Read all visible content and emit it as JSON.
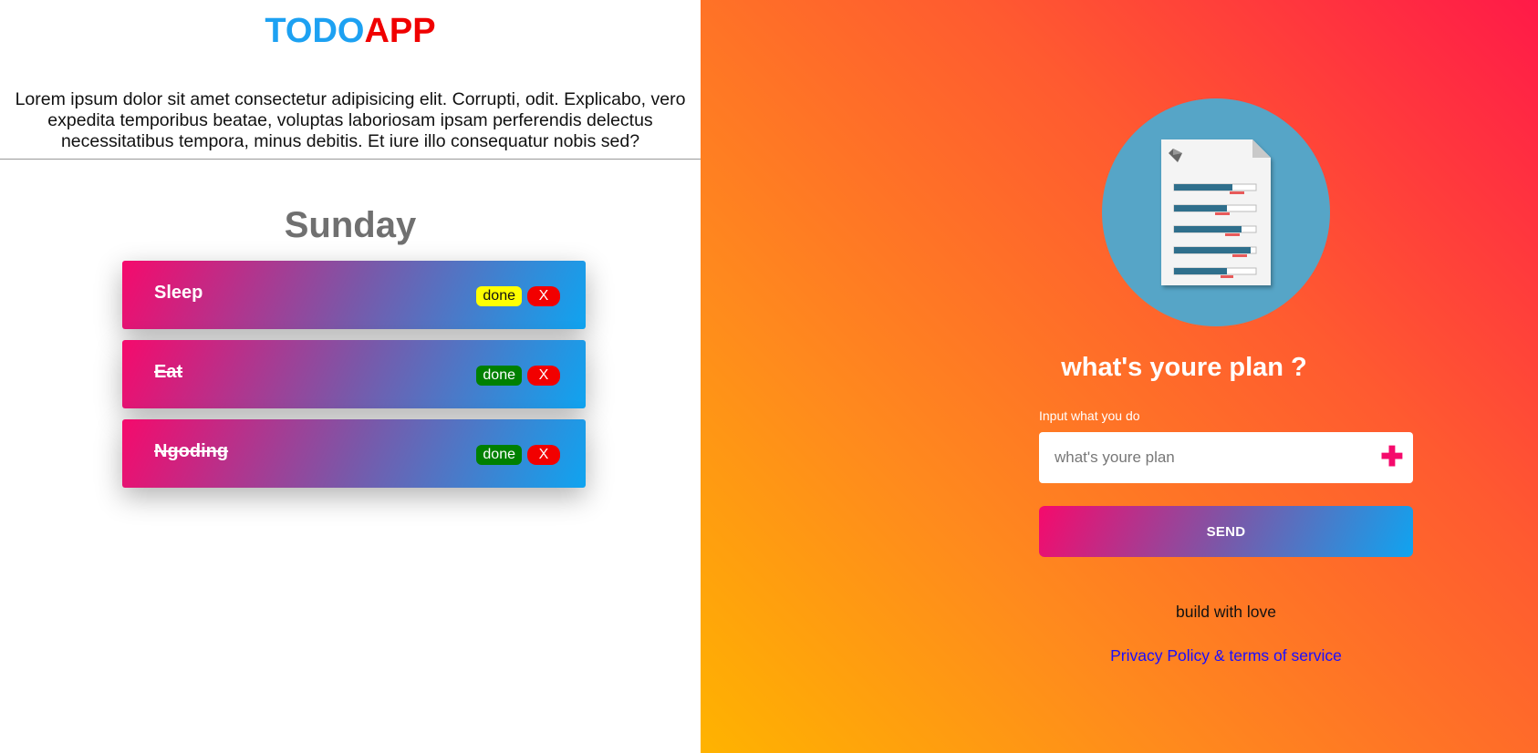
{
  "header": {
    "logo_part1": "TODO",
    "logo_part2": "APP",
    "intro": "Lorem ipsum dolor sit amet consectetur adipisicing elit. Corrupti, odit. Explicabo, vero expedita temporibus beatae, voluptas laboriosam ipsam perferendis delectus necessitatibus tempora, minus debitis. Et iure illo consequatur nobis sed?"
  },
  "day": "Sunday",
  "tasks": [
    {
      "label": "Sleep",
      "done_label": "done",
      "delete_label": "X",
      "completed": false,
      "done_color": "#ffff00",
      "done_text_color": "#111111"
    },
    {
      "label": "Eat",
      "done_label": "done",
      "delete_label": "X",
      "completed": true,
      "done_color": "#008000",
      "done_text_color": "#ffffff"
    },
    {
      "label": "Ngoding",
      "done_label": "done",
      "delete_label": "X",
      "completed": true,
      "done_color": "#008000",
      "done_text_color": "#ffffff"
    }
  ],
  "form": {
    "title": "what's youre plan ?",
    "input_label": "Input what you do",
    "input_placeholder": "what's youre plan",
    "input_value": "",
    "add_icon": "plus-icon",
    "send_label": "SEND"
  },
  "footer": {
    "tagline": "build with love",
    "privacy_link": "Privacy Policy & terms of service"
  },
  "colors": {
    "todo": "#1da1f2",
    "app": "#f00000",
    "delete": "#f20000",
    "accent_pink": "#f50a6c",
    "accent_blue": "#0fa4f0"
  }
}
